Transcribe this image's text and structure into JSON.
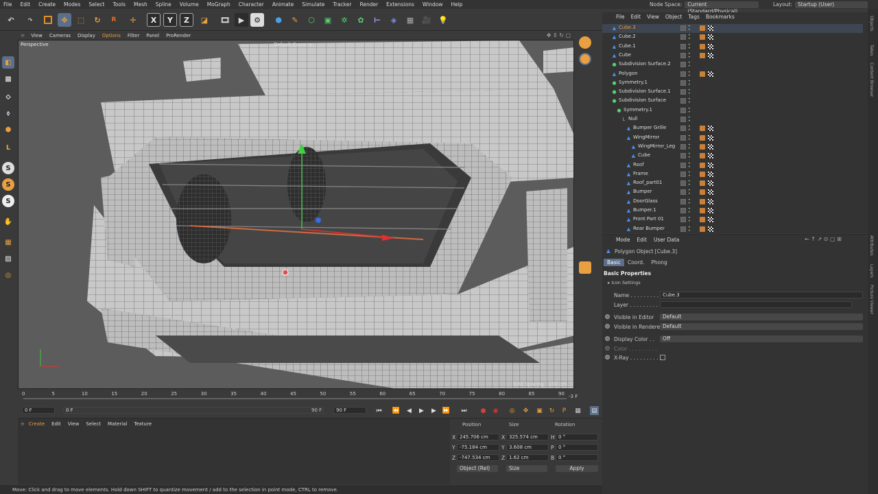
{
  "menubar": {
    "items": [
      "File",
      "Edit",
      "Create",
      "Modes",
      "Select",
      "Tools",
      "Mesh",
      "Spline",
      "Volume",
      "MoGraph",
      "Character",
      "Animate",
      "Simulate",
      "Tracker",
      "Render",
      "Extensions",
      "Window",
      "Help"
    ],
    "node_space_label": "Node Space:",
    "node_space_value": "Current (Standard/Physical)",
    "layout_label": "Layout:",
    "layout_value": "Startup (User)"
  },
  "viewport": {
    "menu": [
      "View",
      "Cameras",
      "Display",
      "Options",
      "Filter",
      "Panel",
      "ProRender"
    ],
    "view_name": "Perspective",
    "camera": "Default Camera",
    "grid_spacing": "Grid Spacing : 100 cm"
  },
  "timeline": {
    "ticks": [
      "0",
      "5",
      "10",
      "15",
      "20",
      "25",
      "30",
      "35",
      "40",
      "45",
      "50",
      "55",
      "60",
      "65",
      "70",
      "75",
      "80",
      "85",
      "90"
    ],
    "end_marker": "-3 F",
    "current_frame": "0 F",
    "start_frame": "0 F",
    "end_frame": "90 F",
    "max_frame": "90 F"
  },
  "material_manager": {
    "menu": [
      "Create",
      "Edit",
      "View",
      "Select",
      "Material",
      "Texture"
    ]
  },
  "coordinates": {
    "headers": [
      "Position",
      "Size",
      "Rotation"
    ],
    "rows": [
      {
        "axis": "X",
        "pos": "245.706 cm",
        "size": "325.574 cm",
        "rot_axis": "H",
        "rot": "0 °"
      },
      {
        "axis": "Y",
        "pos": "-75.184 cm",
        "size": "3.608 cm",
        "rot_axis": "P",
        "rot": "0 °"
      },
      {
        "axis": "Z",
        "pos": "-747.534 cm",
        "size": "1.62 cm",
        "rot_axis": "B",
        "rot": "0 °"
      }
    ],
    "mode": "Object (Rel)",
    "size_mode": "Size",
    "apply": "Apply"
  },
  "status": "Move: Click and drag to move elements. Hold down SHIFT to quantize movement / add to the selection in point mode, CTRL to remove.",
  "object_manager": {
    "menu": [
      "File",
      "Edit",
      "View",
      "Object",
      "Tags",
      "Bookmarks"
    ],
    "objects": [
      {
        "name": "Cube.3",
        "indent": 0,
        "icon": "polygon-icon",
        "selected": true
      },
      {
        "name": "Cube.2",
        "indent": 0,
        "icon": "polygon-icon"
      },
      {
        "name": "Cube.1",
        "indent": 0,
        "icon": "polygon-icon"
      },
      {
        "name": "Cube",
        "indent": 0,
        "icon": "polygon-icon"
      },
      {
        "name": "Subdivision Surface.2",
        "indent": 0,
        "icon": "subdivision-icon"
      },
      {
        "name": "Polygon",
        "indent": 0,
        "icon": "polygon-icon"
      },
      {
        "name": "Symmetry.1",
        "indent": 0,
        "icon": "symmetry-icon"
      },
      {
        "name": "Subdivision Surface.1",
        "indent": 0,
        "icon": "subdivision-icon"
      },
      {
        "name": "Subdivision Surface",
        "indent": 0,
        "icon": "subdivision-icon"
      },
      {
        "name": "Symmetry.1",
        "indent": 1,
        "icon": "symmetry-icon"
      },
      {
        "name": "Null",
        "indent": 2,
        "icon": "null-icon"
      },
      {
        "name": "Bumper Grille",
        "indent": 3,
        "icon": "polygon-icon"
      },
      {
        "name": "WingMirror",
        "indent": 3,
        "icon": "polygon-icon"
      },
      {
        "name": "WingMirror_Leg",
        "indent": 4,
        "icon": "polygon-icon"
      },
      {
        "name": "Cube",
        "indent": 4,
        "icon": "polygon-icon"
      },
      {
        "name": "Roof",
        "indent": 3,
        "icon": "polygon-icon"
      },
      {
        "name": "Frame",
        "indent": 3,
        "icon": "polygon-icon"
      },
      {
        "name": "Roof_part01",
        "indent": 3,
        "icon": "polygon-icon"
      },
      {
        "name": "Bumper",
        "indent": 3,
        "icon": "polygon-icon"
      },
      {
        "name": "DoorGlass",
        "indent": 3,
        "icon": "polygon-icon"
      },
      {
        "name": "Bumper.1",
        "indent": 3,
        "icon": "polygon-icon"
      },
      {
        "name": "Front Part 01",
        "indent": 3,
        "icon": "polygon-icon"
      },
      {
        "name": "Rear Bumper",
        "indent": 3,
        "icon": "polygon-icon"
      }
    ]
  },
  "attributes": {
    "menu": [
      "Mode",
      "Edit",
      "User Data"
    ],
    "object_title": "Polygon Object [Cube.3]",
    "tabs": [
      "Basic",
      "Coord.",
      "Phong"
    ],
    "section": "Basic Properties",
    "subsection": "Icon Settings",
    "fields": {
      "name_label": "Name . . . . . . . . . . . .",
      "name_value": "Cube.3",
      "layer_label": "Layer . . . . . . . . . . . .",
      "vis_editor_label": "Visible in Editor",
      "vis_editor_value": "Default",
      "vis_render_label": "Visible in Renderer",
      "vis_render_value": "Default",
      "display_color_label": "Display Color . .",
      "display_color_value": "Off",
      "color_label": "Color . . . . . . . . .",
      "xray_label": "X-Ray . . . . . . . . . ."
    }
  },
  "side_tabs": [
    "Objects",
    "Takes",
    "Content Browser",
    "Layers",
    "Attributes",
    "Layers",
    "Picture Viewer"
  ]
}
